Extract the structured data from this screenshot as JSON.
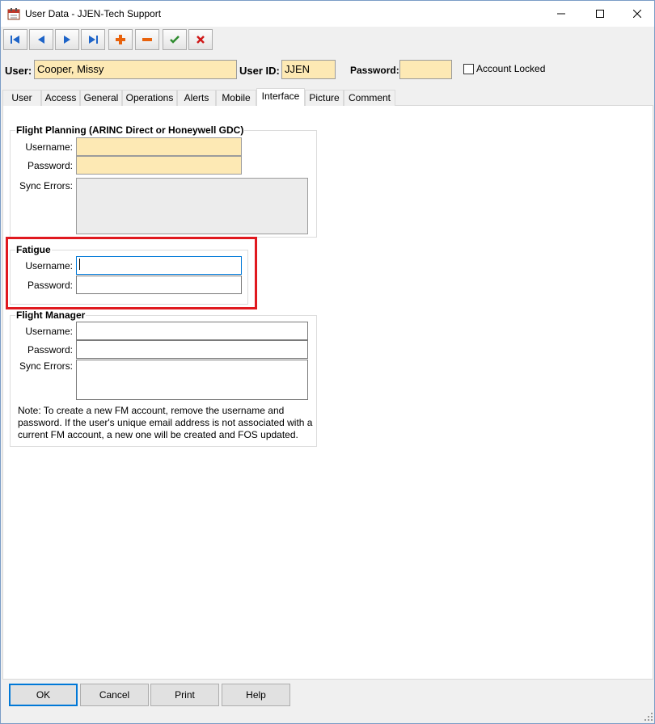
{
  "window": {
    "title": "User Data - JJEN-Tech Support"
  },
  "toolbar": {
    "buttons": [
      {
        "name": "first-record",
        "glyph": "|◄"
      },
      {
        "name": "previous-record",
        "glyph": "◄"
      },
      {
        "name": "next-record",
        "glyph": "►"
      },
      {
        "name": "last-record",
        "glyph": "►|"
      },
      {
        "name": "add-record",
        "glyph": "+"
      },
      {
        "name": "delete-record",
        "glyph": "−"
      },
      {
        "name": "save-record",
        "glyph": "✔"
      },
      {
        "name": "cancel-record",
        "glyph": "✖"
      }
    ]
  },
  "header": {
    "user_label": "User:",
    "user_value": "Cooper, Missy",
    "userid_label": "User ID:",
    "userid_value": "JJEN",
    "password_label": "Password:",
    "password_value": "",
    "account_locked_label": "Account Locked",
    "account_locked_checked": false
  },
  "tabs": [
    "User",
    "Access",
    "General",
    "Operations",
    "Alerts",
    "Mobile",
    "Interface",
    "Picture",
    "Comment"
  ],
  "active_tab": "Interface",
  "flight_planning": {
    "title": "Flight Planning (ARINC Direct or Honeywell GDC)",
    "username_label": "Username:",
    "username_value": "",
    "password_label": "Password:",
    "password_value": "",
    "sync_errors_label": "Sync Errors:",
    "sync_errors_value": ""
  },
  "fatigue": {
    "title": "Fatigue",
    "username_label": "Username:",
    "username_value": "",
    "password_label": "Password:",
    "password_value": ""
  },
  "flight_manager": {
    "title": "Flight Manager",
    "username_label": "Username:",
    "username_value": "",
    "password_label": "Password:",
    "password_value": "",
    "sync_errors_label": "Sync Errors:",
    "sync_errors_value": "",
    "note": "Note: To create a new FM account, remove the username and password. If the user's unique email address is not associated with a current FM account, a new one will be created and FOS updated."
  },
  "buttons": {
    "ok": "OK",
    "cancel": "Cancel",
    "print": "Print",
    "help": "Help"
  },
  "colors": {
    "field_yellow": "#fde9b4",
    "highlight_red": "#e0191f",
    "toolbar_blue": "#1e64c8",
    "add_orange": "#e8620c",
    "ok_green": "#2e8b2e",
    "cancel_red": "#d01818"
  }
}
